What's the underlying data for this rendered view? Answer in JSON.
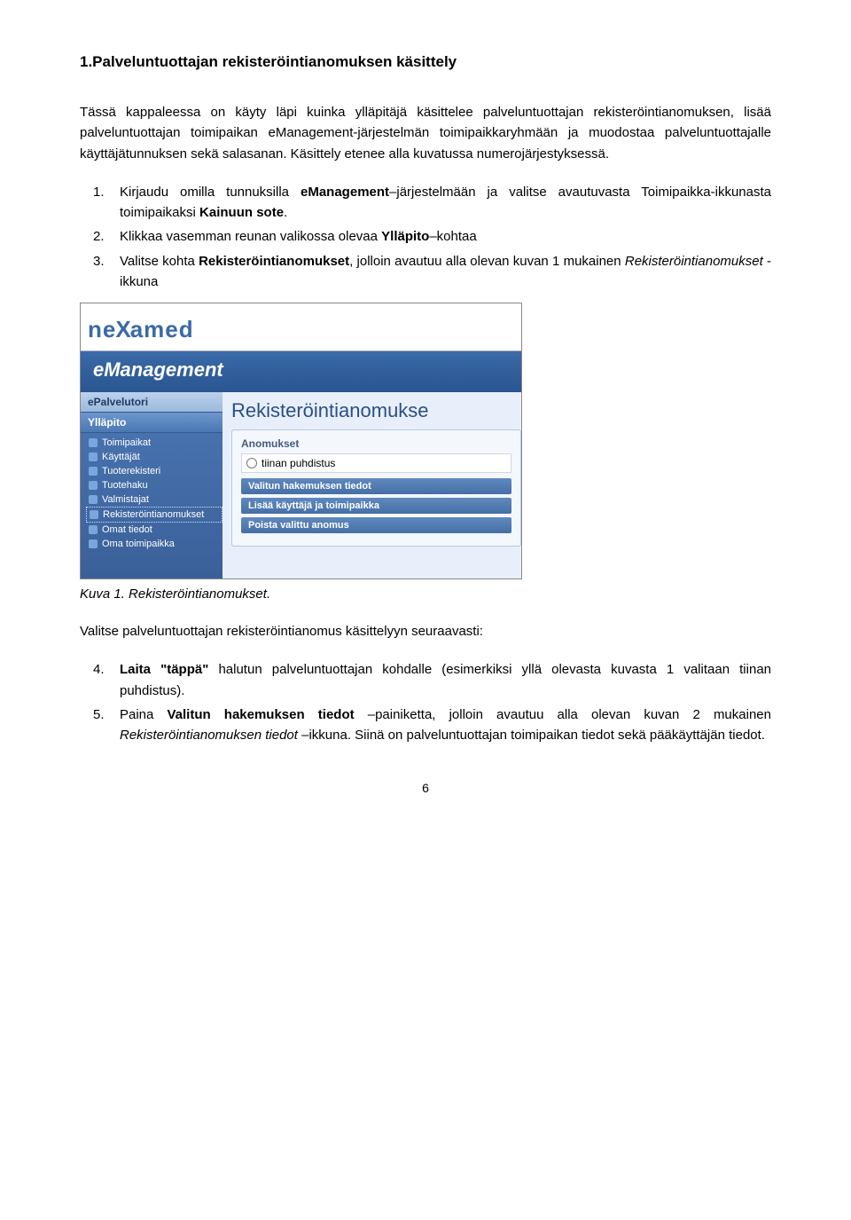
{
  "heading": "1.Palveluntuottajan rekisteröintianomuksen käsittely",
  "intro_p1": "Tässä kappaleessa on käyty läpi kuinka ylläpitäjä käsittelee palveluntuottajan rekisteröintianomuksen, lisää palveluntuottajan toimipaikan eManagement-järjestelmän toimipaikkaryhmään ja muodostaa palveluntuottajalle käyttäjätunnuksen sekä salasanan. Käsittely etenee alla kuvatussa numerojärjestyksessä.",
  "list1": [
    {
      "num": "1.",
      "text_before": "Kirjaudu omilla tunnuksilla ",
      "bold1": "eManagement",
      "text_mid": "–järjestelmään ja valitse avautuvasta Toimipaikka-ikkunasta toimipaikaksi ",
      "bold2": "Kainuun sote",
      "text_after": "."
    },
    {
      "num": "2.",
      "text_before": "Klikkaa vasemman reunan valikossa olevaa ",
      "bold1": "Ylläpito",
      "text_mid": "–kohtaa",
      "bold2": "",
      "text_after": ""
    },
    {
      "num": "3.",
      "text_before": "Valitse kohta ",
      "bold1": "Rekisteröintianomukset",
      "text_mid": ", jolloin avautuu alla olevan kuvan 1 mukainen ",
      "ital1": "Rekisteröintianomukset",
      "text_after": " -ikkuna"
    }
  ],
  "screenshot": {
    "logo_pre": "ne",
    "logo_x": "X",
    "logo_post": "amed",
    "emgmt": "eManagement",
    "section_light": "ePalvelutori",
    "section_dark": "Ylläpito",
    "menu": [
      "Toimipaikat",
      "Käyttäjät",
      "Tuoterekisteri",
      "Tuotehaku",
      "Valmistajat",
      "Rekisteröintianomukset",
      "Omat tiedot",
      "Oma toimipaikka"
    ],
    "content_title": "Rekisteröintianomukse",
    "card_heading": "Anomukset",
    "radio_label": "tiinan puhdistus",
    "buttons": [
      "Valitun hakemuksen tiedot",
      "Lisää käyttäjä ja toimipaikka",
      "Poista valittu anomus"
    ]
  },
  "caption": "Kuva 1. Rekisteröintianomukset.",
  "p_after_fig": "Valitse palveluntuottajan rekisteröintianomus käsittelyyn seuraavasti:",
  "list2": [
    {
      "num": "4.",
      "bold1": "Laita \"täppä\"",
      "text_after": " halutun palveluntuottajan kohdalle (esimerkiksi yllä olevasta kuvasta 1 valitaan tiinan puhdistus)."
    },
    {
      "num": "5.",
      "text_before": "Paina ",
      "bold1": "Valitun hakemuksen tiedot",
      "text_mid": " –painiketta, jolloin avautuu alla olevan kuvan 2 mukainen ",
      "ital1": "Rekisteröintianomuksen tiedot",
      "text_after": " –ikkuna. Siinä on palveluntuottajan toimipaikan tiedot sekä pääkäyttäjän tiedot."
    }
  ],
  "page_num": "6"
}
